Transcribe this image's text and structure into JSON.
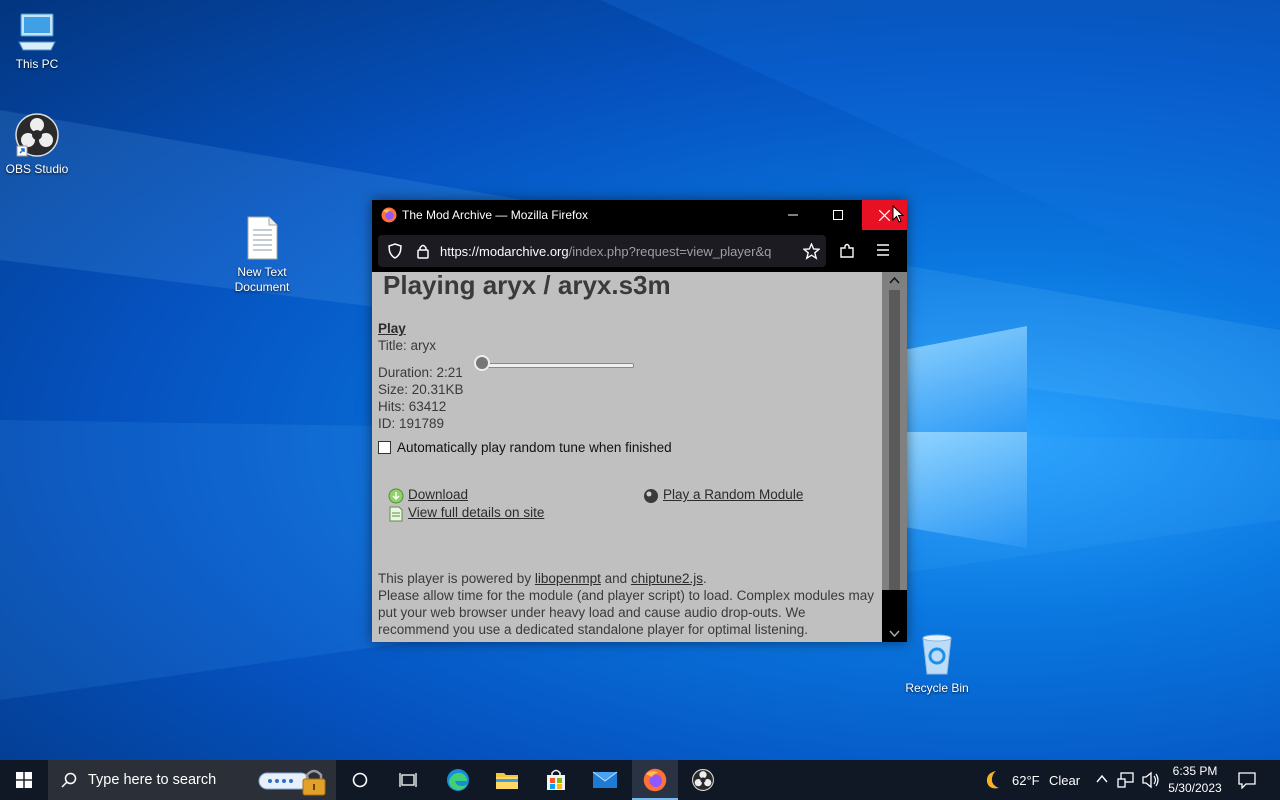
{
  "desktop": {
    "icons": [
      {
        "label": "This PC",
        "icon": "computer-icon"
      },
      {
        "label": "OBS Studio",
        "icon": "obs-icon"
      },
      {
        "label": "New Text Document",
        "label_line1": "New Text",
        "label_line2": "Document",
        "icon": "text-document-icon"
      },
      {
        "label": "Recycle Bin",
        "icon": "recycle-bin-icon"
      }
    ]
  },
  "window": {
    "title": "The Mod Archive — Mozilla Firefox",
    "url_host": "https://modarchive.org",
    "url_rest": "/index.php?request=view_player&q",
    "page": {
      "heading": "Playing aryx / aryx.s3m",
      "play_link": "Play",
      "title_line": "Title: aryx",
      "duration_line": "Duration: 2:21",
      "size_line": "Size: 20.31KB",
      "hits_line": "Hits: 63412",
      "id_line": "ID: 191789",
      "progress": 0.0,
      "autoplay_label": "Automatically play random tune when finished",
      "autoplay_checked": false,
      "download_link": "Download",
      "random_link": "Play a Random Module",
      "details_link": "View full details on site",
      "powered_prefix": "This player is powered by",
      "powered_lib1": "libopenmpt",
      "powered_and": "and",
      "powered_lib2": "chiptune2.js",
      "powered_suffix": ".",
      "note": "Please allow time for the module (and player script) to load. Complex modules may put your web browser under heavy load and cause audio drop-outs. We recommend you use a dedicated standalone player for optimal listening."
    }
  },
  "taskbar": {
    "search_placeholder": "Type here to search",
    "weather_temp": "62°F",
    "weather_cond": "Clear",
    "time": "6:35 PM",
    "date": "5/30/2023"
  },
  "colors": {
    "close_button": "#e81123",
    "page_bg": "#c0c0c0",
    "taskbar": "#101725",
    "active_indicator": "#76b9ed"
  }
}
